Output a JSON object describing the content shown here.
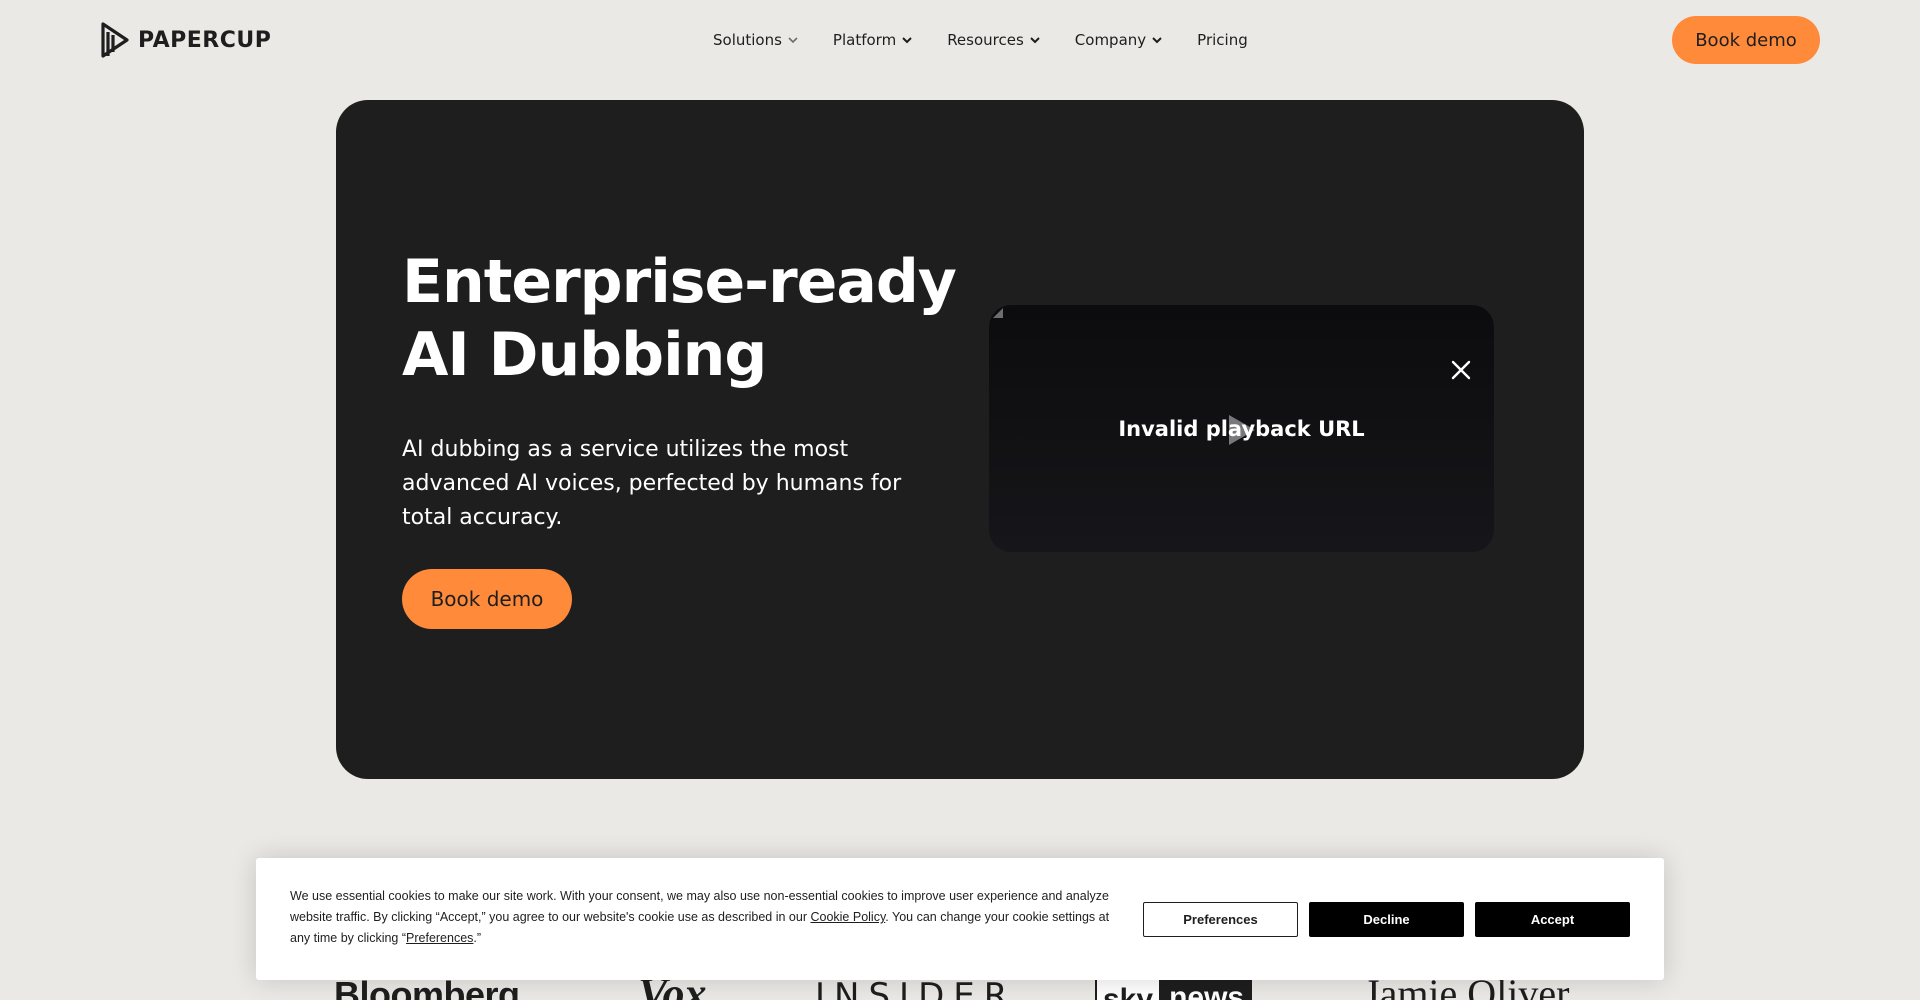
{
  "header": {
    "brand": "PAPERCUP",
    "nav": [
      {
        "label": "Solutions",
        "has_dropdown": true
      },
      {
        "label": "Platform",
        "has_dropdown": true
      },
      {
        "label": "Resources",
        "has_dropdown": true
      },
      {
        "label": "Company",
        "has_dropdown": true
      },
      {
        "label": "Pricing",
        "has_dropdown": false
      }
    ],
    "cta_label": "Book demo"
  },
  "hero": {
    "title_line1": "Enterprise-ready",
    "title_line2": "AI Dubbing",
    "subtitle": "AI dubbing as a service utilizes the most advanced AI voices, perfected by humans for total accuracy.",
    "cta_label": "Book demo"
  },
  "video": {
    "message": "Invalid playback URL",
    "close_icon": "close-icon",
    "play_icon": "play-icon"
  },
  "logos": {
    "items": [
      "Bloomberg",
      "Vox",
      "INSIDER",
      "sky",
      "news",
      "Jamie Oliver"
    ]
  },
  "cookie": {
    "text_part1": "We use essential cookies to make our site work. With your consent, we may also use non-essential cookies to improve user experience and analyze website traffic. By clicking “Accept,” you agree to our website's cookie use as described in our ",
    "policy_link": "Cookie Policy",
    "text_part2": ". You can change your cookie settings at any time by clicking “",
    "preferences_link": "Preferences",
    "text_part3": ".”",
    "buttons": {
      "preferences": "Preferences",
      "decline": "Decline",
      "accept": "Accept"
    }
  },
  "colors": {
    "background": "#ebe9e6",
    "hero_background": "#1e1e1f",
    "accent": "#ff8a3a",
    "button_dark": "#000000"
  }
}
